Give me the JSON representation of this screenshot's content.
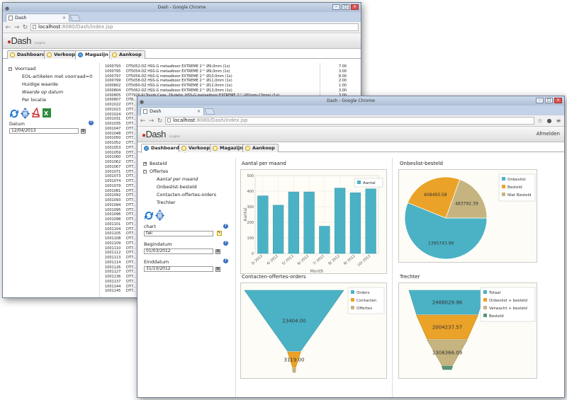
{
  "back_window": {
    "title": "Dash - Google Chrome",
    "tab_title": "Dash",
    "tab_close": "×",
    "url_host": "localhost",
    "url_rest": ":8080/Dash/index.jsp",
    "logo": "Dash",
    "logo_sub": "inspire",
    "tabs": [
      "Dashboards",
      "Verkoop",
      "Magazijn",
      "Aankoop"
    ],
    "tree": {
      "group": "Voorraad",
      "items": [
        "EOL-artikelen met voorraad=0",
        "Huidige waarde",
        "Waarde op datum",
        "Per locatie"
      ]
    },
    "date_label": "Datum",
    "date_value": "12/04/2013",
    "list": [
      {
        "id": "1000793",
        "desc": "DT5052-DZ HSS-G metaalboor EXTREME 2™ Ø9,0mm (1x)",
        "qty": "7.00"
      },
      {
        "id": "1000795",
        "desc": "DT5054-DZ HSS-G metaalboor EXTREME 2™ Ø9,0mm (1x)",
        "qty": "3.00"
      },
      {
        "id": "1000797",
        "desc": "DT5056-DZ HSS-G metaalboor EXTREME 2™ Ø10,0mm (1x)",
        "qty": "8.00"
      },
      {
        "id": "1000799",
        "desc": "DT5058-DZ HSS-G metaalboor EXTREME 2™ Ø11,0mm (1x)",
        "qty": "2.00"
      },
      {
        "id": "1000802",
        "desc": "DT5060-DZ HSS-G metaalboor EXTREME 2™ Ø12,0mm (1x)",
        "qty": "1.00"
      },
      {
        "id": "1000804",
        "desc": "DT5062-DZ HSS-G metaalboor EXTREME 2™ Ø13,0mm (1x)",
        "qty": "3.00"
      },
      {
        "id": "1000805",
        "desc": "DT7926-XJ Tough Case, 29-delig, HSS-G metaalboor EXTREME 2™ (Ø1mm-13mm) (1x)",
        "qty": "3.00"
      },
      {
        "id": "1000807",
        "desc": "DT8..",
        "qty": ""
      },
      {
        "id": "1001022",
        "desc": "DT7..",
        "qty": ""
      },
      {
        "id": "1001023",
        "desc": "DT7..",
        "qty": ""
      },
      {
        "id": "1001024",
        "desc": "DT7..",
        "qty": ""
      },
      {
        "id": "1001031",
        "desc": "DT7..",
        "qty": ""
      },
      {
        "id": "1001035",
        "desc": "DT7..",
        "qty": ""
      },
      {
        "id": "1001047",
        "desc": "DT7..",
        "qty": ""
      },
      {
        "id": "1001048",
        "desc": "DT7..",
        "qty": ""
      },
      {
        "id": "1001050",
        "desc": "DT7..",
        "qty": ""
      },
      {
        "id": "1001052",
        "desc": "DT7..",
        "qty": ""
      },
      {
        "id": "1001053",
        "desc": "DT7..",
        "qty": ""
      },
      {
        "id": "1001059",
        "desc": "DT7..",
        "qty": ""
      },
      {
        "id": "1001060",
        "desc": "DT7..",
        "qty": ""
      },
      {
        "id": "1001062",
        "desc": "DT7..",
        "qty": ""
      },
      {
        "id": "1001067",
        "desc": "DT7..",
        "qty": ""
      },
      {
        "id": "1001071",
        "desc": "DT7..",
        "qty": ""
      },
      {
        "id": "1001073",
        "desc": "DT7..",
        "qty": ""
      },
      {
        "id": "1001074",
        "desc": "DT7..",
        "qty": ""
      },
      {
        "id": "1001079",
        "desc": "DT7..",
        "qty": ""
      },
      {
        "id": "1001081",
        "desc": "DT7..",
        "qty": ""
      },
      {
        "id": "1001092",
        "desc": "DT7..",
        "qty": ""
      },
      {
        "id": "1001093",
        "desc": "DT7..",
        "qty": ""
      },
      {
        "id": "1001094",
        "desc": "DT7..",
        "qty": ""
      },
      {
        "id": "1001095",
        "desc": "DT7..",
        "qty": ""
      },
      {
        "id": "1001096",
        "desc": "DT7..",
        "qty": ""
      },
      {
        "id": "1001098",
        "desc": "DT7..",
        "qty": ""
      },
      {
        "id": "1001101",
        "desc": "DT7..",
        "qty": ""
      },
      {
        "id": "1001104",
        "desc": "DT7..",
        "qty": ""
      },
      {
        "id": "1001105",
        "desc": "DT7..",
        "qty": ""
      },
      {
        "id": "1001108",
        "desc": "DT7..",
        "qty": ""
      },
      {
        "id": "1001109",
        "desc": "DT7..",
        "qty": ""
      },
      {
        "id": "1001110",
        "desc": "DT7..",
        "qty": ""
      },
      {
        "id": "1001112",
        "desc": "DT7..",
        "qty": ""
      },
      {
        "id": "1001113",
        "desc": "DT7..",
        "qty": ""
      },
      {
        "id": "1001114",
        "desc": "DT7..",
        "qty": ""
      },
      {
        "id": "1001126",
        "desc": "DT7..",
        "qty": ""
      },
      {
        "id": "1001127",
        "desc": "DT7..",
        "qty": ""
      },
      {
        "id": "1001136",
        "desc": "DT7..",
        "qty": ""
      },
      {
        "id": "1001137",
        "desc": "DT7..",
        "qty": ""
      },
      {
        "id": "1001144",
        "desc": "DT7..",
        "qty": ""
      },
      {
        "id": "1001145",
        "desc": "DT7..",
        "qty": ""
      }
    ]
  },
  "front_window": {
    "title": "Dash - Google Chrome",
    "tab_title": "Dash",
    "tab_close": "×",
    "url_host": "localhost",
    "url_rest": ":8080/Dash/index.jsp",
    "logo": "Dash",
    "logo_sub": "inspire",
    "logout_label": "Afmelden",
    "tabs": [
      "Dashboards",
      "Verkoop",
      "Magazijn",
      "Aankoop"
    ],
    "tree": {
      "group1": "Besteld",
      "group2": "Offertes",
      "items": [
        "Aantal per maand",
        "Onbeslist-besteld",
        "Contacten-offertes-orders",
        "Trechter"
      ]
    },
    "chart_label": "chart",
    "chart_value": "twi",
    "begin_label": "Begindatum",
    "begin_value": "01/03/2012",
    "end_label": "Einddatum",
    "end_value": "31/10/2012"
  },
  "colors": {
    "teal": "#4bb2c5",
    "orange": "#eaa228",
    "tan": "#c5b47f",
    "green": "#579575"
  },
  "chart_data": [
    {
      "type": "bar",
      "title": "Aantal per maand",
      "categories": [
        "3/ 2012",
        "4/ 2012",
        "5/ 2012",
        "6/ 2012",
        "7/ 2012",
        "8/ 2012",
        "9/ 2012",
        "10/ 2012"
      ],
      "series": [
        {
          "name": "Aantal",
          "values": [
            370,
            310,
            395,
            395,
            175,
            420,
            390,
            415
          ]
        }
      ],
      "xlabel": "Month",
      "ylabel": "Aantal",
      "ylim": [
        0,
        500
      ],
      "yticks": [
        0,
        100,
        200,
        300,
        400,
        500
      ],
      "grid": true,
      "legend": "top-right"
    },
    {
      "type": "pie",
      "title": "Onbeslist-besteld",
      "categories": [
        "Onbeslist",
        "Besteld",
        "Niet Besteld"
      ],
      "values": [
        1395743.99,
        608493.58,
        483792.39
      ],
      "labels": [
        "1395743.99",
        "608493.58",
        "483792.39"
      ],
      "legend": "top-right"
    },
    {
      "type": "funnel",
      "title": "Contacten-offertes-orders",
      "categories": [
        "Orders",
        "Contacten",
        "Offertes"
      ],
      "values": [
        23404.0,
        3119.0,
        750
      ],
      "labels": [
        "23404.00",
        "3119.00",
        ""
      ],
      "legend": "top-right"
    },
    {
      "type": "funnel",
      "title": "Trechter",
      "categories": [
        "Totaal",
        "Onbeslist + besteld",
        "Verwacht + besteld",
        "Besteld"
      ],
      "values": [
        2488029.96,
        2004237.57,
        1306366.09,
        350000
      ],
      "labels": [
        "2488029.96",
        "2004237.57",
        "1306366.09",
        ""
      ],
      "legend": "top-right"
    }
  ]
}
